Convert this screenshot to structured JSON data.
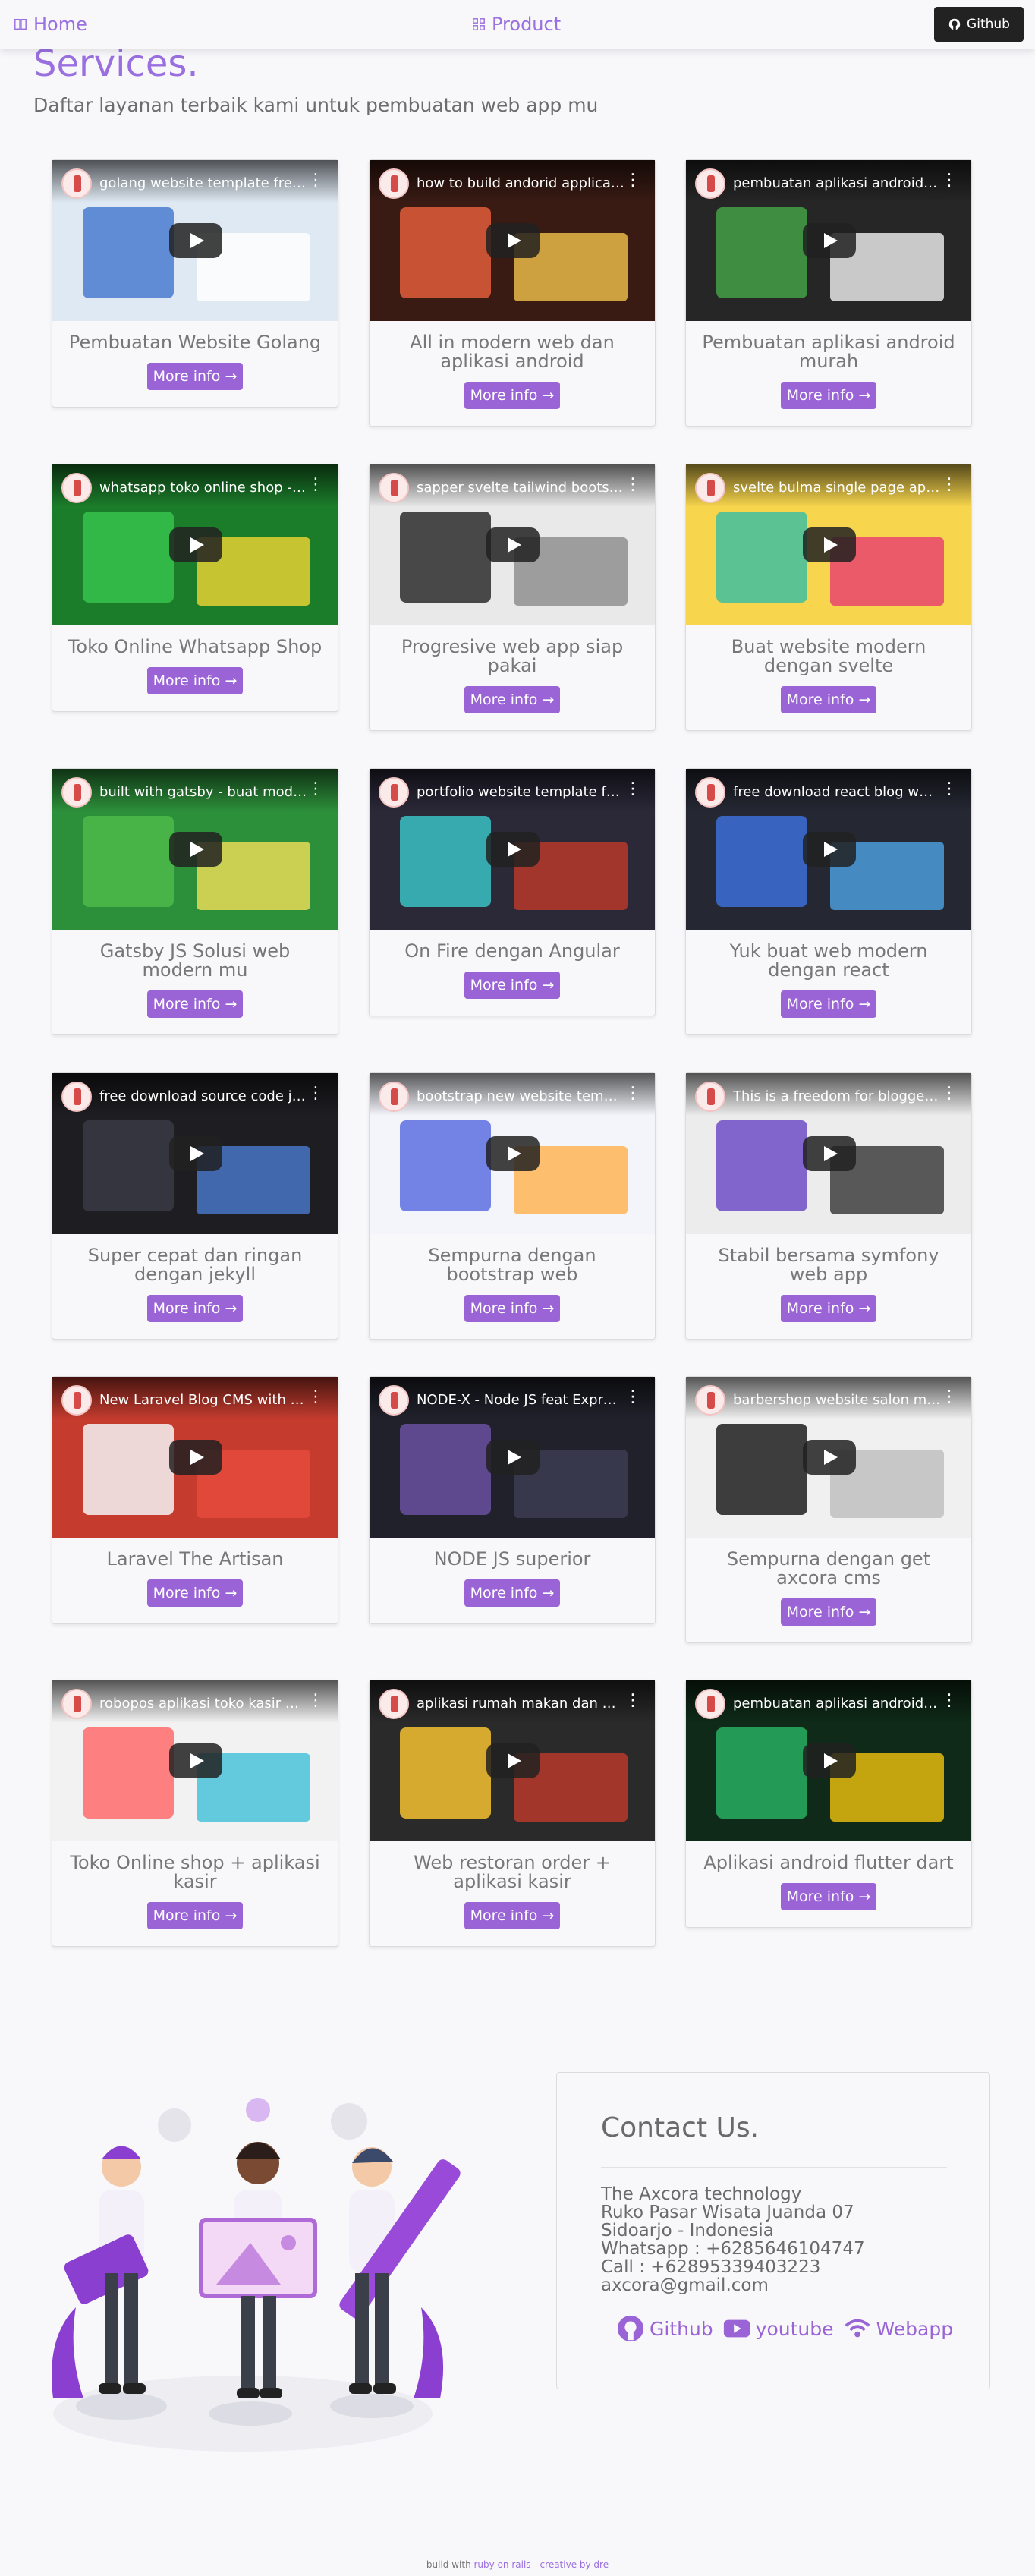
{
  "nav": {
    "home": "Home",
    "product": "Product",
    "github": "Github"
  },
  "header": {
    "title": "Services.",
    "subtitle": "Daftar layanan terbaik kami untuk pembuatan web app mu"
  },
  "services": [
    {
      "video_title": "golang website template free ...",
      "title": "Pembuatan Website Golang",
      "button": "More info →",
      "colors": [
        "#dfe9f3",
        "#4a7bd0",
        "#ffffff"
      ]
    },
    {
      "video_title": "how to build andorid applicati...",
      "title": "All in modern web dan aplikasi android",
      "button": "More info →",
      "colors": [
        "#3a1b14",
        "#e25c3a",
        "#f3c34a"
      ]
    },
    {
      "video_title": "pembuatan aplikasi android m...",
      "title": "Pembuatan aplikasi android murah",
      "button": "More info →",
      "colors": [
        "#262626",
        "#43a047",
        "#f2f2f2"
      ]
    },
    {
      "video_title": "whatsapp toko online shop - ...",
      "title": "Toko Online Whatsapp Shop",
      "button": "More info →",
      "colors": [
        "#1b7d2a",
        "#36c24b",
        "#f3d633"
      ]
    },
    {
      "video_title": "sapper svelte tailwind bootstr...",
      "title": "Progresive web app siap pakai",
      "button": "More info →",
      "colors": [
        "#e9e9e9",
        "#2c2c2c",
        "#8a8a8a"
      ]
    },
    {
      "video_title": "svelte bulma single page app ...",
      "title": "Buat website modern dengan svelte",
      "button": "More info →",
      "colors": [
        "#f7d54d",
        "#3fbfa0",
        "#e63b6f"
      ]
    },
    {
      "video_title": "built with gatsby - buat moder...",
      "title": "Gatsby JS Solusi web modern mu",
      "button": "More info →",
      "colors": [
        "#2c8f3a",
        "#4dbb4b",
        "#f4e05a"
      ]
    },
    {
      "video_title": "portfolio website template fre...",
      "title": "On Fire dengan Angular",
      "button": "More info →",
      "colors": [
        "#2b2838",
        "#3ac1c5",
        "#c0392b"
      ]
    },
    {
      "video_title": "free download react blog web...",
      "title": "Yuk buat web modern dengan react",
      "button": "More info →",
      "colors": [
        "#252833",
        "#3c6fd8",
        "#4fa3e6"
      ]
    },
    {
      "video_title": "free download source code je...",
      "title": "Super cepat dan ringan dengan jekyll",
      "button": "More info →",
      "colors": [
        "#1e1e22",
        "#3a3a44",
        "#4a7bd0"
      ]
    },
    {
      "video_title": "bootstrap new website templa...",
      "title": "Sempurna dengan bootstrap web",
      "button": "More info →",
      "colors": [
        "#f4f5fb",
        "#5c6ee0",
        "#ffb14a"
      ]
    },
    {
      "video_title": "This is a freedom for blogger symfony webapp blog fre...",
      "title": "Stabil bersama symfony web app",
      "button": "More info →",
      "colors": [
        "#ececec",
        "#6f4ec7",
        "#333333"
      ]
    },
    {
      "video_title": "New Laravel Blog CMS with L...",
      "title": "Laravel The Artisan",
      "button": "More info →",
      "colors": [
        "#c53b2e",
        "#f4f4f4",
        "#e74c3c"
      ]
    },
    {
      "video_title": "NODE-X - Node JS feat Expres...",
      "title": "NODE JS superior",
      "button": "More info →",
      "colors": [
        "#20212b",
        "#6a4fa0",
        "#3d3f55"
      ]
    },
    {
      "video_title": "barbershop website salon mo...",
      "title": "Sempurna dengan get axcora cms",
      "button": "More info →",
      "colors": [
        "#f0f0f0",
        "#1d1d1d",
        "#bdbdbd"
      ]
    },
    {
      "video_title": "robopos aplikasi toko kasir + ...",
      "title": "Toko Online shop + aplikasi kasir",
      "button": "More info →",
      "colors": [
        "#f2f2f2",
        "#ff6b6b",
        "#3fbfd8"
      ]
    },
    {
      "video_title": "aplikasi rumah makan dan we...",
      "title": "Web restoran order + aplikasi kasir",
      "button": "More info →",
      "colors": [
        "#2a2a2a",
        "#f3c12f",
        "#c0392b"
      ]
    },
    {
      "video_title": "pembuatan aplikasi android w...",
      "title": "Aplikasi android flutter dart",
      "button": "More info →",
      "colors": [
        "#0f2a18",
        "#27ae60",
        "#f1c40f"
      ]
    }
  ],
  "contact": {
    "title": "Contact Us.",
    "lines": [
      "The Axcora technology",
      "Ruko Pasar Wisata Juanda 07",
      "Sidoarjo - Indonesia",
      "Whatsapp : +6285646104747",
      "Call : +62895339403223",
      "axcora@gmail.com"
    ],
    "links": {
      "github": "Github",
      "youtube": "youtube",
      "webapp": "Webapp"
    }
  },
  "footer": {
    "prefix": "build with",
    "framework": "ruby on rails",
    "separator": "-",
    "credit": "creative by dre"
  },
  "colors": {
    "accent": "#9a6fe0",
    "button": "#9a63d6",
    "background": "#f8f8fb"
  }
}
